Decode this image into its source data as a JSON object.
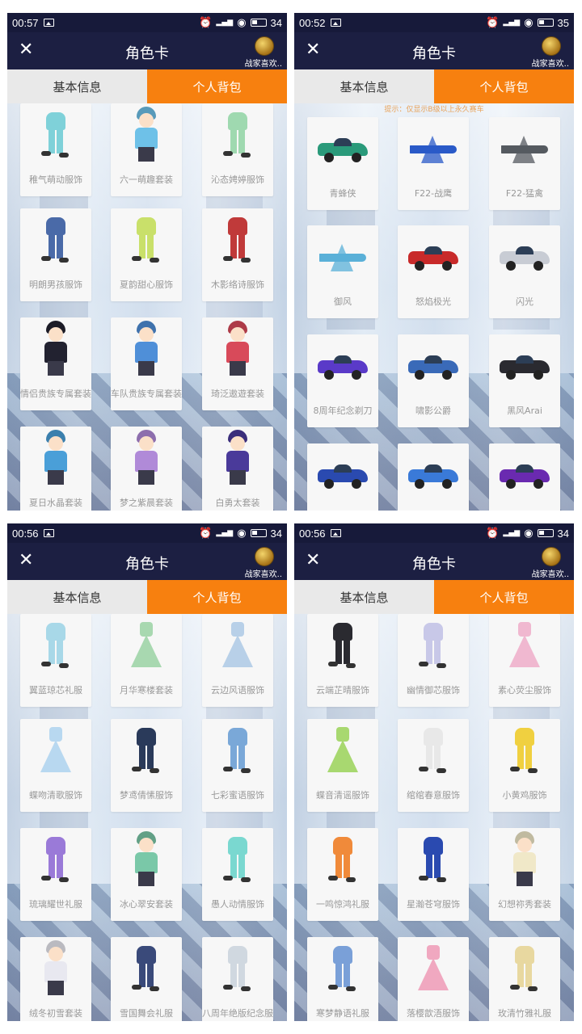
{
  "panels": [
    {
      "status_time": "00:57",
      "battery": "34",
      "title": "角色卡",
      "username": "战家喜欢..",
      "tab_basic": "基本信息",
      "tab_bag": "个人背包",
      "hint": "",
      "items": [
        {
          "label": "稚气萌动服饰",
          "icon": "outfit-icon",
          "color": "#7fd1d9"
        },
        {
          "label": "六一萌趣套装",
          "icon": "character-icon",
          "color": "#6ec1e8"
        },
        {
          "label": "沁态娉婷服饰",
          "icon": "outfit-icon",
          "color": "#9fd9b0"
        },
        {
          "label": "明朗男孩服饰",
          "icon": "outfit-icon",
          "color": "#4a6aa8"
        },
        {
          "label": "夏韵甜心服饰",
          "icon": "outfit-icon",
          "color": "#c9e06a"
        },
        {
          "label": "木影络诗服饰",
          "icon": "outfit-icon",
          "color": "#c03a3a"
        },
        {
          "label": "情侣贵族专属套装",
          "icon": "character-icon",
          "color": "#222230"
        },
        {
          "label": "车队贵族专属套装",
          "icon": "character-icon",
          "color": "#4f8fd8"
        },
        {
          "label": "琦泛遨遊套装",
          "icon": "character-icon",
          "color": "#d84a5a"
        },
        {
          "label": "夏日水晶套装",
          "icon": "character-icon",
          "color": "#4a9fd8"
        },
        {
          "label": "梦之紫晨套装",
          "icon": "character-icon",
          "color": "#b08ad8"
        },
        {
          "label": "白勇太套装",
          "icon": "character-icon",
          "color": "#4a3a9a"
        }
      ]
    },
    {
      "status_time": "00:52",
      "battery": "35",
      "title": "角色卡",
      "username": "战家喜欢..",
      "tab_basic": "基本信息",
      "tab_bag": "个人背包",
      "hint": "提示：仅显示B级以上永久赛车",
      "items": [
        {
          "label": "青蜂侠",
          "icon": "car-icon",
          "color": "#2a9a7a"
        },
        {
          "label": "F22-战鹰",
          "icon": "jet-icon",
          "color": "#2a5ac8"
        },
        {
          "label": "F22-猛禽",
          "icon": "jet-icon",
          "color": "#555a60"
        },
        {
          "label": "御风",
          "icon": "jet-icon",
          "color": "#5ab0d8"
        },
        {
          "label": "怒焰极光",
          "icon": "car-icon",
          "color": "#c82a2a"
        },
        {
          "label": "闪光",
          "icon": "car-icon",
          "color": "#c8ccd4"
        },
        {
          "label": "8周年纪念剃刀",
          "icon": "car-icon",
          "color": "#5a3ac8"
        },
        {
          "label": "啸影公爵",
          "icon": "car-icon",
          "color": "#3a6ab8"
        },
        {
          "label": "黑风Arai",
          "icon": "car-icon",
          "color": "#2a2a30"
        },
        {
          "label": "",
          "icon": "car-icon",
          "color": "#2a4ab0"
        },
        {
          "label": "",
          "icon": "car-icon",
          "color": "#3a7ad8"
        },
        {
          "label": "",
          "icon": "car-icon",
          "color": "#6a2ab0"
        }
      ]
    },
    {
      "status_time": "00:56",
      "battery": "34",
      "title": "角色卡",
      "username": "战家喜欢..",
      "tab_basic": "基本信息",
      "tab_bag": "个人背包",
      "hint": "",
      "items": [
        {
          "label": "翼蓝琼芯礼服",
          "icon": "outfit-icon",
          "color": "#a8d8e8"
        },
        {
          "label": "月华寒楼套装",
          "icon": "dress-icon",
          "color": "#a8d8b0"
        },
        {
          "label": "云边风语服饰",
          "icon": "dress-icon",
          "color": "#b8d0e8"
        },
        {
          "label": "蝶吻清歌服饰",
          "icon": "dress-icon",
          "color": "#b8d8f0"
        },
        {
          "label": "梦鸢倩愫服饰",
          "icon": "outfit-icon",
          "color": "#2a3a5a"
        },
        {
          "label": "七彩蜜语服饰",
          "icon": "outfit-icon",
          "color": "#7aa8d8"
        },
        {
          "label": "琉璃耀世礼服",
          "icon": "outfit-icon",
          "color": "#9a7ad8"
        },
        {
          "label": "冰心翠安套装",
          "icon": "character-icon",
          "color": "#7ac8a8"
        },
        {
          "label": "愚人动情服饰",
          "icon": "outfit-icon",
          "color": "#7ad8d0"
        },
        {
          "label": "绒冬初雪套装",
          "icon": "character-icon",
          "color": "#e8e8f0"
        },
        {
          "label": "雪国舞会礼服",
          "icon": "outfit-icon",
          "color": "#3a4a7a"
        },
        {
          "label": "八周年绝版纪念服",
          "icon": "outfit-icon",
          "color": "#d0d8e0"
        }
      ]
    },
    {
      "status_time": "00:56",
      "battery": "34",
      "title": "角色卡",
      "username": "战家喜欢..",
      "tab_basic": "基本信息",
      "tab_bag": "个人背包",
      "hint": "",
      "items": [
        {
          "label": "云端芷晴服饰",
          "icon": "outfit-icon",
          "color": "#2a2a30"
        },
        {
          "label": "幽情御芯服饰",
          "icon": "outfit-icon",
          "color": "#c8c8e8"
        },
        {
          "label": "素心荧尘服饰",
          "icon": "dress-icon",
          "color": "#f0b8d0"
        },
        {
          "label": "蝶音清谣服饰",
          "icon": "dress-icon",
          "color": "#a8d870"
        },
        {
          "label": "绾绾春意服饰",
          "icon": "outfit-icon",
          "color": "#e8e8e8"
        },
        {
          "label": "小黄鸡服饰",
          "icon": "outfit-icon",
          "color": "#f0d040"
        },
        {
          "label": "一鸣惊鸿礼服",
          "icon": "outfit-icon",
          "color": "#f08a3a"
        },
        {
          "label": "星瀚苍穹服饰",
          "icon": "outfit-icon",
          "color": "#2a4ab0"
        },
        {
          "label": "幻想祢秀套装",
          "icon": "character-icon",
          "color": "#f0e8c8"
        },
        {
          "label": "寒梦静语礼服",
          "icon": "outfit-icon",
          "color": "#7aa0d8"
        },
        {
          "label": "落樱歆浯服饰",
          "icon": "dress-icon",
          "color": "#f0a8c0"
        },
        {
          "label": "玫清竹雅礼服",
          "icon": "outfit-icon",
          "color": "#e8d8a0"
        }
      ]
    }
  ]
}
